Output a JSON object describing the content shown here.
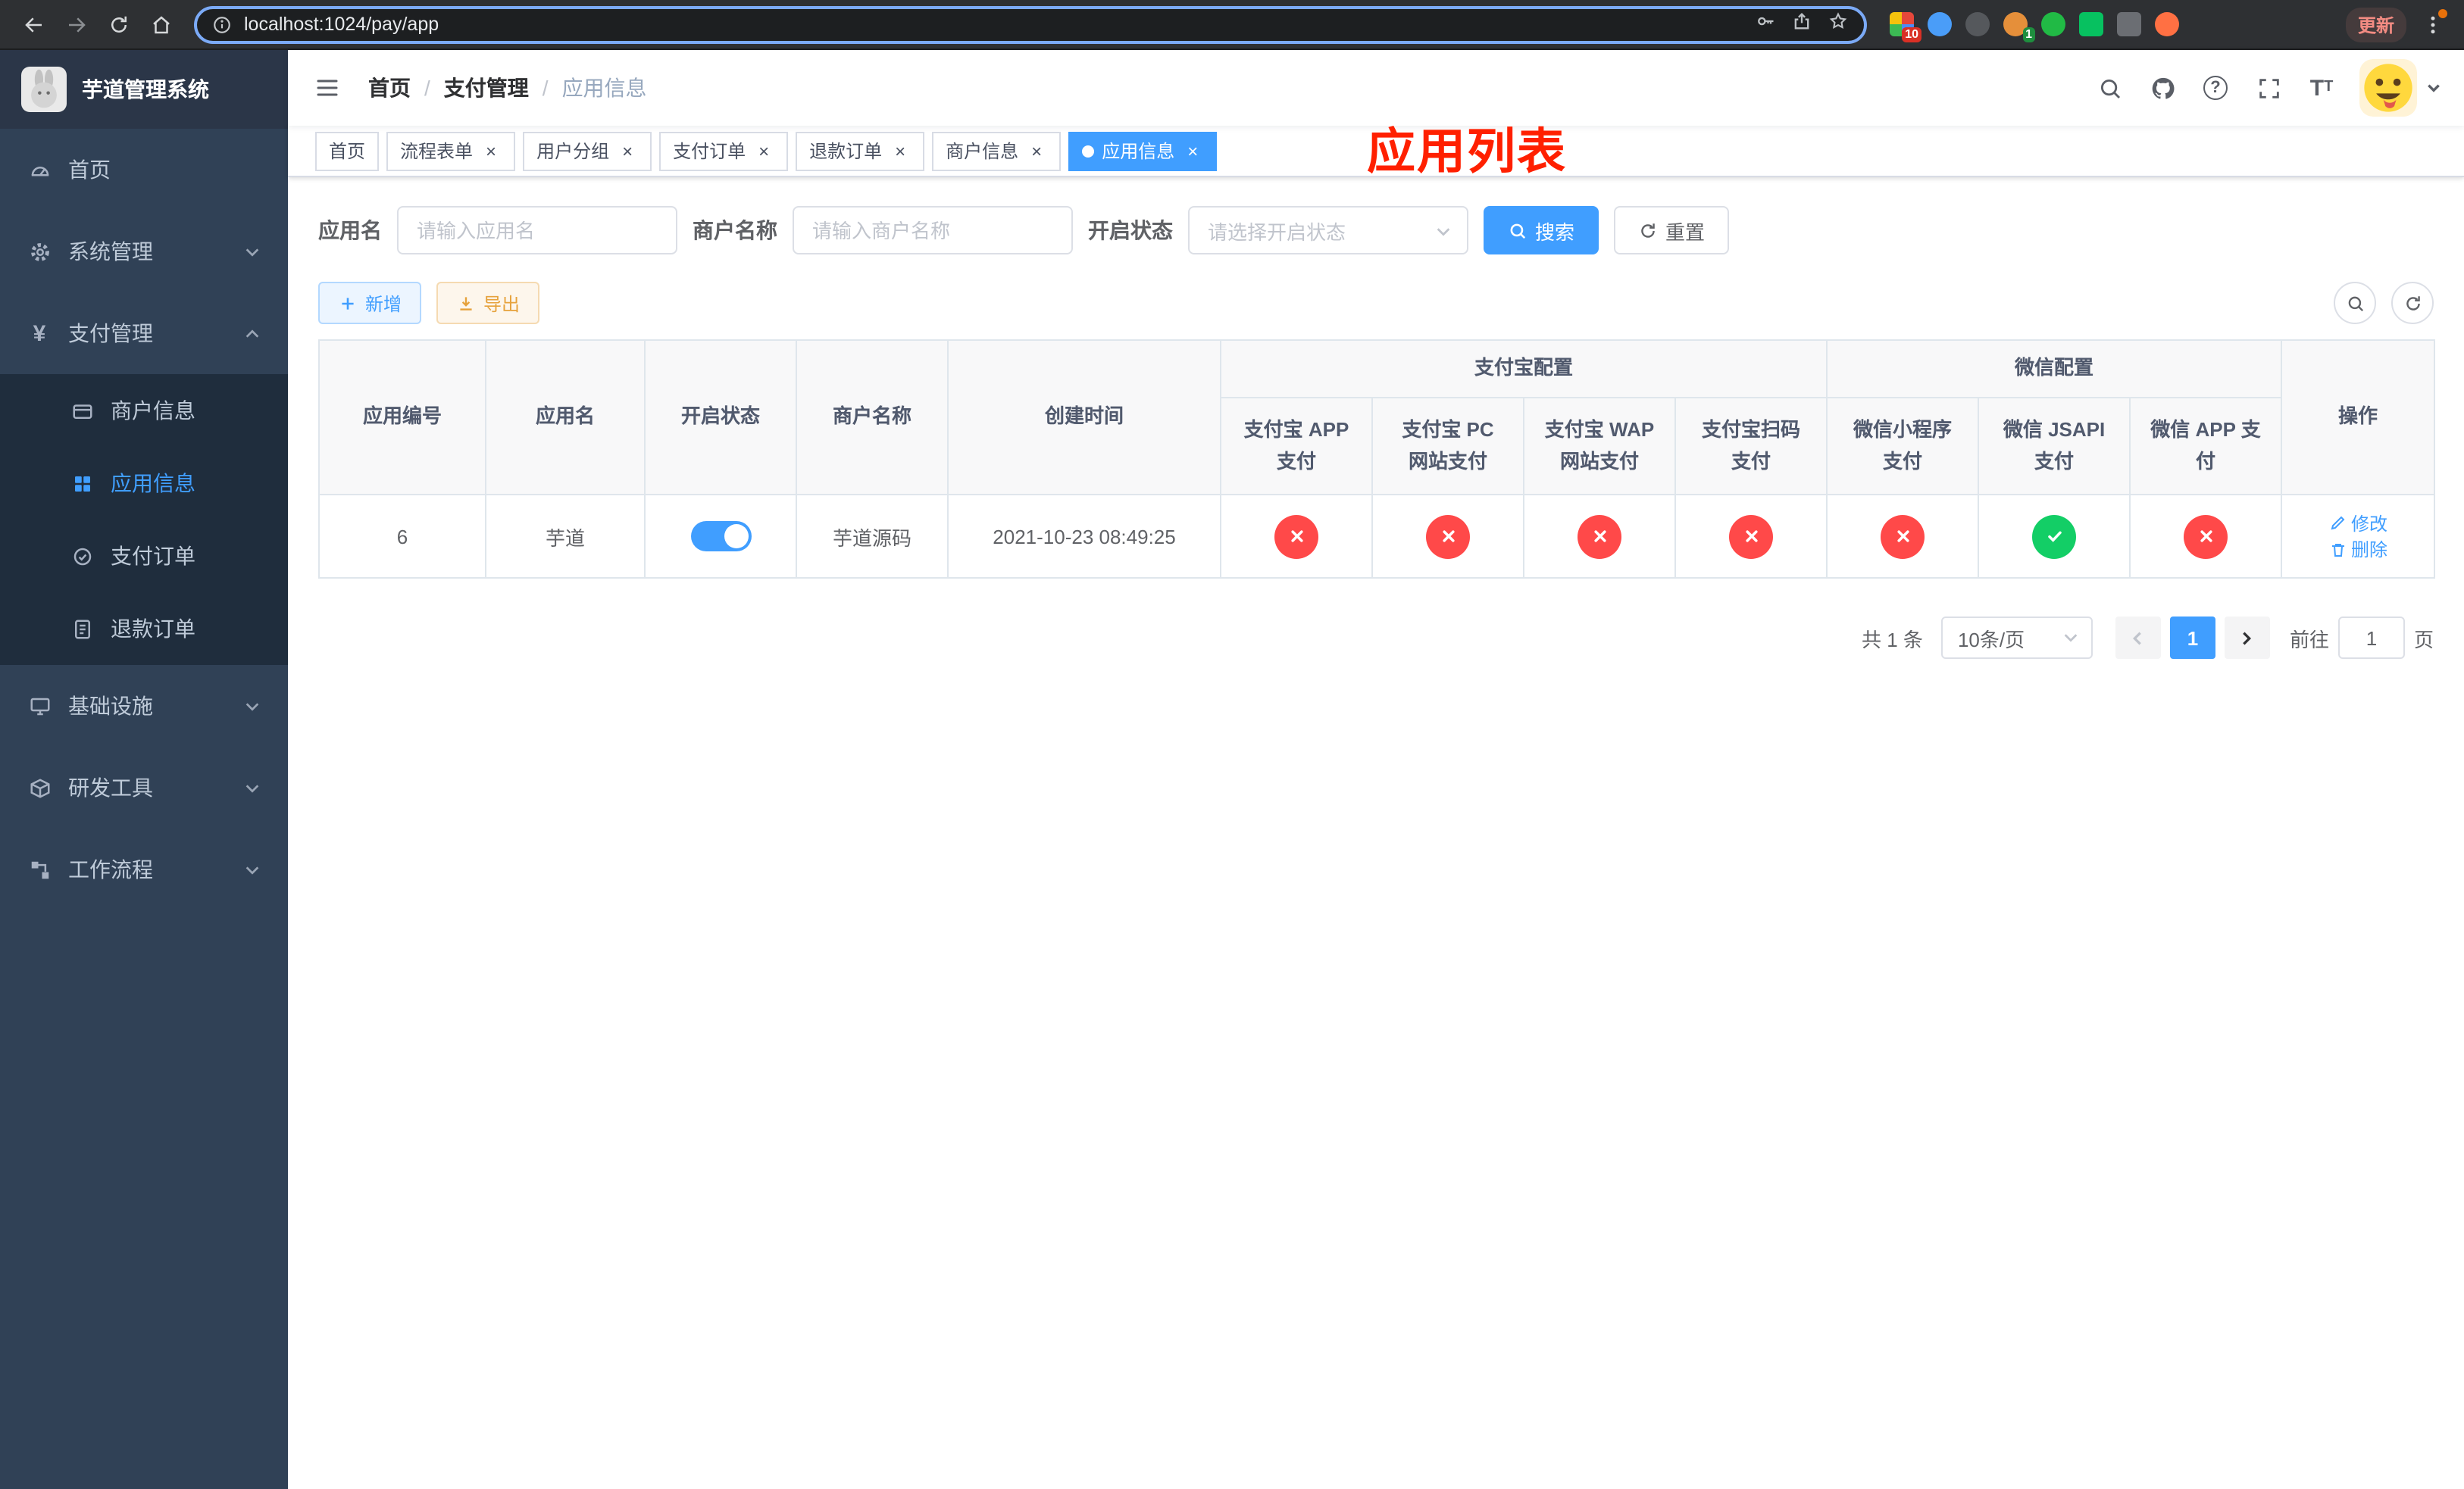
{
  "browser": {
    "url": "localhost:1024/pay/app",
    "update_button": "更新",
    "extension_badge_1": "10",
    "extension_badge_2": "1"
  },
  "sidebar": {
    "app_title": "芋道管理系统",
    "menu": [
      {
        "label": "首页"
      },
      {
        "label": "系统管理"
      },
      {
        "label": "支付管理"
      },
      {
        "label": "商户信息"
      },
      {
        "label": "应用信息"
      },
      {
        "label": "支付订单"
      },
      {
        "label": "退款订单"
      },
      {
        "label": "基础设施"
      },
      {
        "label": "研发工具"
      },
      {
        "label": "工作流程"
      }
    ]
  },
  "header": {
    "breadcrumb": [
      {
        "label": "首页"
      },
      {
        "label": "支付管理"
      },
      {
        "label": "应用信息"
      }
    ],
    "annotation": "应用列表"
  },
  "tabs": [
    {
      "label": "首页"
    },
    {
      "label": "流程表单"
    },
    {
      "label": "用户分组"
    },
    {
      "label": "支付订单"
    },
    {
      "label": "退款订单"
    },
    {
      "label": "商户信息"
    },
    {
      "label": "应用信息"
    }
  ],
  "filters": {
    "app_name_label": "应用名",
    "app_name_placeholder": "请输入应用名",
    "merchant_label": "商户名称",
    "merchant_placeholder": "请输入商户名称",
    "status_label": "开启状态",
    "status_placeholder": "请选择开启状态",
    "search_button": "搜索",
    "reset_button": "重置"
  },
  "toolbar": {
    "add_button": "新增",
    "export_button": "导出"
  },
  "table": {
    "headers": {
      "app_id": "应用编号",
      "app_name": "应用名",
      "status": "开启状态",
      "merchant_name": "商户名称",
      "create_time": "创建时间",
      "alipay_group": "支付宝配置",
      "wechat_group": "微信配置",
      "alipay_app": "支付宝 APP 支付",
      "alipay_pc": "支付宝 PC 网站支付",
      "alipay_wap": "支付宝 WAP 网站支付",
      "alipay_qr": "支付宝扫码支付",
      "wechat_mini": "微信小程序支付",
      "wechat_jsapi": "微信 JSAPI 支付",
      "wechat_app": "微信 APP 支付",
      "actions": "操作"
    },
    "rows": [
      {
        "app_id": "6",
        "app_name": "芋道",
        "status_on": true,
        "merchant_name": "芋道源码",
        "create_time": "2021-10-23 08:49:25",
        "alipay_app": false,
        "alipay_pc": false,
        "alipay_wap": false,
        "alipay_qr": false,
        "wechat_mini": false,
        "wechat_jsapi": true,
        "wechat_app": false,
        "edit_label": "修改",
        "delete_label": "删除"
      }
    ]
  },
  "pagination": {
    "total_text": "共 1 条",
    "page_size_label": "10条/页",
    "current_page": "1",
    "goto_label": "前往",
    "goto_value": "1",
    "goto_unit": "页"
  },
  "colors": {
    "primary": "#409EFF",
    "success": "#13ce66",
    "danger": "#ff4949",
    "warning": "#e6a23c",
    "sidebar_bg": "#304156",
    "submenu_bg": "#1f2d3d",
    "annotation_red": "#ff2000"
  },
  "icons": {
    "enabled-icon": "check",
    "disabled-icon": "x",
    "search-icon": "magnifier",
    "github-icon": "octocat",
    "help-icon": "?",
    "fullscreen-icon": "expand-corners",
    "font-size-icon": "T"
  }
}
